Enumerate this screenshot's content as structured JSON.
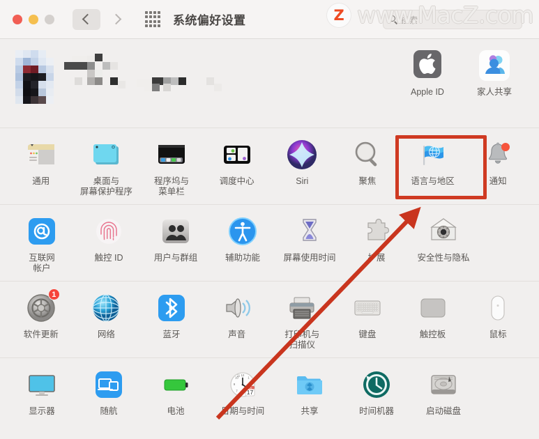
{
  "window": {
    "title": "系统偏好设置",
    "traffic_lights": [
      "close-red",
      "minimize-yellow",
      "zoom-gray-disabled"
    ],
    "back_label": "‹",
    "forward_label": "›",
    "grid_button": "show-all-grid-icon"
  },
  "search": {
    "placeholder": "搜索",
    "value": ""
  },
  "watermark": {
    "logo_letter": "Z",
    "text": "www.MacZ.com"
  },
  "identity": {
    "censored": true,
    "tiles": [
      {
        "label": "Apple ID",
        "icon": "apple-logo-icon"
      },
      {
        "label": "家人共享",
        "icon": "family-sharing-icon"
      }
    ]
  },
  "sections": [
    {
      "name": "personal-row",
      "items": [
        {
          "label": "通用",
          "icon": "general-icon"
        },
        {
          "label": "桌面与\n屏幕保护程序",
          "icon": "desktop-screensaver-icon"
        },
        {
          "label": "程序坞与\n菜单栏",
          "icon": "dock-menubar-icon"
        },
        {
          "label": "调度中心",
          "icon": "mission-control-icon"
        },
        {
          "label": "Siri",
          "icon": "siri-icon"
        },
        {
          "label": "聚焦",
          "icon": "spotlight-icon"
        },
        {
          "label": "语言与地区",
          "icon": "language-region-icon",
          "highlighted": true
        },
        {
          "label": "通知",
          "icon": "notifications-icon",
          "badge": ""
        }
      ]
    },
    {
      "name": "accounts-row",
      "items": [
        {
          "label": "互联网\n帐户",
          "icon": "internet-accounts-icon"
        },
        {
          "label": "触控 ID",
          "icon": "touch-id-icon"
        },
        {
          "label": "用户与群组",
          "icon": "users-groups-icon"
        },
        {
          "label": "辅助功能",
          "icon": "accessibility-icon"
        },
        {
          "label": "屏幕使用时间",
          "icon": "screen-time-icon"
        },
        {
          "label": "扩展",
          "icon": "extensions-icon"
        },
        {
          "label": "安全性与隐私",
          "icon": "security-privacy-icon"
        }
      ]
    },
    {
      "name": "hardware-row",
      "items": [
        {
          "label": "软件更新",
          "icon": "software-update-icon",
          "badge": "1"
        },
        {
          "label": "网络",
          "icon": "network-icon"
        },
        {
          "label": "蓝牙",
          "icon": "bluetooth-icon"
        },
        {
          "label": "声音",
          "icon": "sound-icon"
        },
        {
          "label": "打印机与\n扫描仪",
          "icon": "printers-scanners-icon"
        },
        {
          "label": "键盘",
          "icon": "keyboard-icon"
        },
        {
          "label": "触控板",
          "icon": "trackpad-icon"
        },
        {
          "label": "鼠标",
          "icon": "mouse-icon"
        }
      ]
    },
    {
      "name": "system-row",
      "items": [
        {
          "label": "显示器",
          "icon": "displays-icon"
        },
        {
          "label": "随航",
          "icon": "sidecar-icon"
        },
        {
          "label": "电池",
          "icon": "battery-icon"
        },
        {
          "label": "日期与时间",
          "icon": "date-time-icon",
          "date_day": "17",
          "date_month": "JUL"
        },
        {
          "label": "共享",
          "icon": "sharing-icon"
        },
        {
          "label": "时间机器",
          "icon": "time-machine-icon"
        },
        {
          "label": "启动磁盘",
          "icon": "startup-disk-icon"
        }
      ]
    }
  ],
  "annotations": {
    "highlight_color": "#cf3a22",
    "highlight_target": "语言与地区",
    "arrow_color": "#c9351e",
    "arrow_from": "日期与时间",
    "arrow_to": "语言与地区"
  }
}
